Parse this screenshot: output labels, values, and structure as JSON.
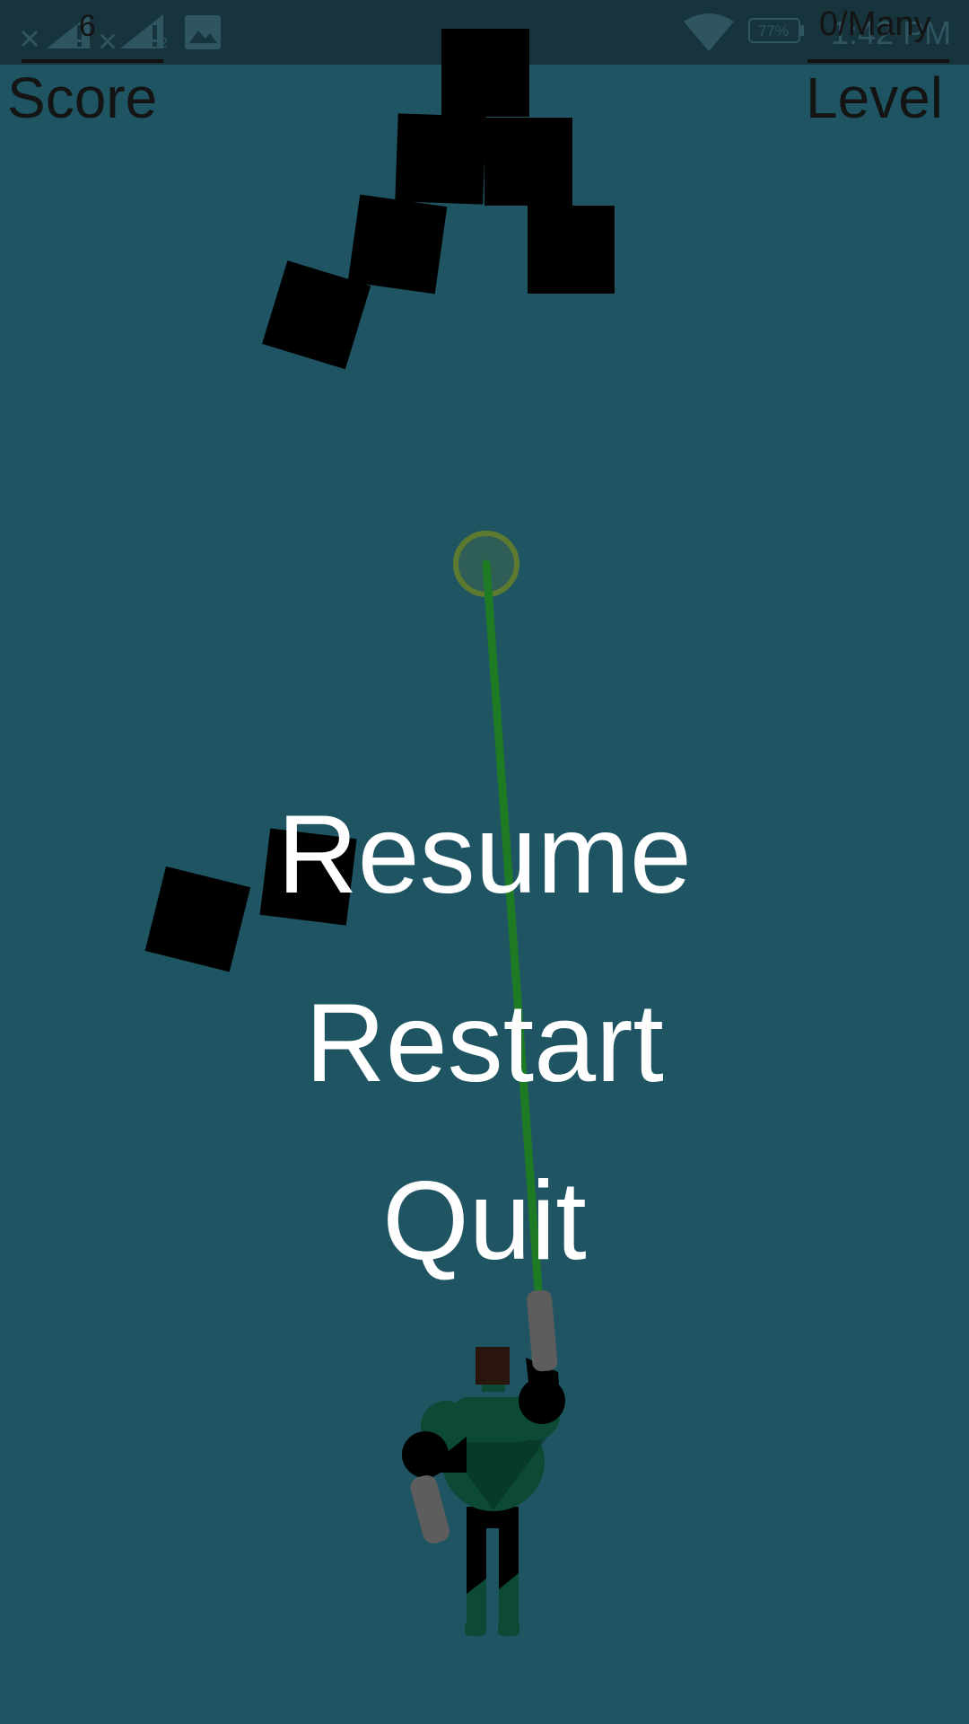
{
  "status_bar": {
    "time": "1:42 PM",
    "battery": "77%",
    "sim1_label": "1",
    "sim2_label": "2",
    "icons": [
      "close-icon",
      "signal-icon",
      "close-icon",
      "signal-icon",
      "image-icon",
      "wifi-icon",
      "battery-icon"
    ]
  },
  "hud": {
    "score_value": "6",
    "score_label": "Score",
    "level_value": "0/Many",
    "level_label": "Level"
  },
  "pause_menu": {
    "resume_label": "Resume",
    "restart_label": "Restart",
    "quit_label": "Quit"
  },
  "colors": {
    "background": "#1f5563",
    "status_bar": "#17333c",
    "block": "#000000",
    "laser": "#1f7a24",
    "target_ring": "#5d7a30",
    "menu_text": "#ffffff",
    "hud_text": "#141414",
    "hero_suit": "#0c4a35",
    "hero_hair": "#2a150c",
    "hero_gray": "#5d5d5d"
  }
}
